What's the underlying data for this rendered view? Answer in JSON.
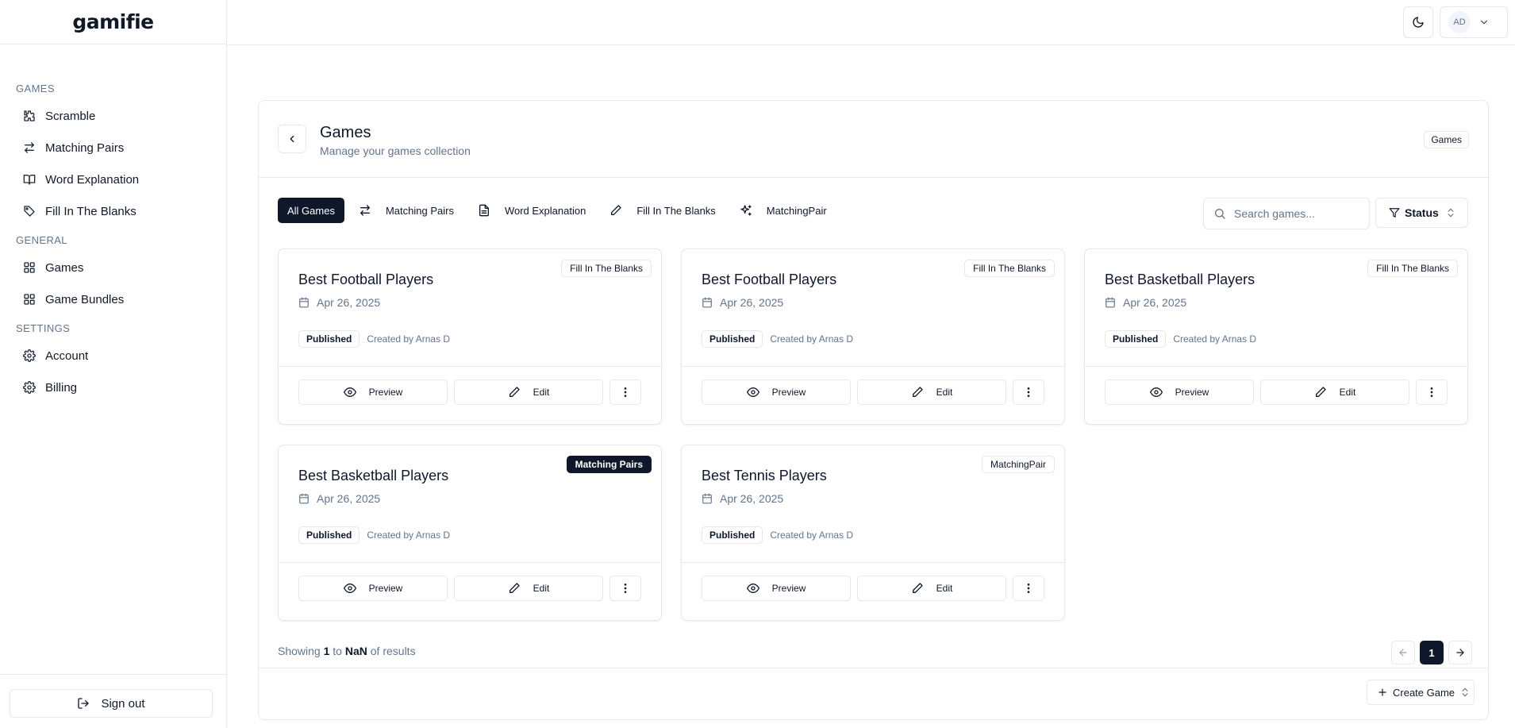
{
  "app": {
    "logo": "gamifie"
  },
  "sidebar": {
    "sections": [
      {
        "title": "GAMES",
        "items": [
          {
            "label": "Scramble",
            "icon": "puzzle-icon"
          },
          {
            "label": "Matching Pairs",
            "icon": "arrows-left-right-icon"
          },
          {
            "label": "Word Explanation",
            "icon": "book-open-icon"
          },
          {
            "label": "Fill In The Blanks",
            "icon": "tag-icon"
          }
        ]
      },
      {
        "title": "GENERAL",
        "items": [
          {
            "label": "Games",
            "icon": "grid-icon"
          },
          {
            "label": "Game Bundles",
            "icon": "grid-icon"
          }
        ]
      },
      {
        "title": "SETTINGS",
        "items": [
          {
            "label": "Account",
            "icon": "gear-icon"
          },
          {
            "label": "Billing",
            "icon": "gear-icon"
          }
        ]
      }
    ],
    "signout_label": "Sign out"
  },
  "topbar": {
    "avatar_initials": "AD"
  },
  "page": {
    "title": "Games",
    "subtitle": "Manage your games collection",
    "breadcrumb": "Games"
  },
  "tabs": [
    {
      "label": "All Games",
      "active": true
    },
    {
      "label": "Matching Pairs",
      "icon": "arrows-left-right-icon"
    },
    {
      "label": "Word Explanation",
      "icon": "file-text-icon"
    },
    {
      "label": "Fill In The Blanks",
      "icon": "pencil-icon"
    },
    {
      "label": "MatchingPair",
      "icon": "sparkles-icon"
    }
  ],
  "search": {
    "placeholder": "Search games...",
    "value": ""
  },
  "filter": {
    "label": "Status"
  },
  "cards": [
    {
      "title": "Best Football Players",
      "date": "Apr 26, 2025",
      "badge": "Fill In The Blanks",
      "badge_dark": false,
      "status": "Published",
      "creator": "Created by Arnas D"
    },
    {
      "title": "Best Football Players",
      "date": "Apr 26, 2025",
      "badge": "Fill In The Blanks",
      "badge_dark": false,
      "status": "Published",
      "creator": "Created by Arnas D"
    },
    {
      "title": "Best Basketball Players",
      "date": "Apr 26, 2025",
      "badge": "Fill In The Blanks",
      "badge_dark": false,
      "status": "Published",
      "creator": "Created by Arnas D"
    },
    {
      "title": "Best Basketball Players",
      "date": "Apr 26, 2025",
      "badge": "Matching Pairs",
      "badge_dark": true,
      "status": "Published",
      "creator": "Created by Arnas D"
    },
    {
      "title": "Best Tennis Players",
      "date": "Apr 26, 2025",
      "badge": "MatchingPair",
      "badge_dark": false,
      "status": "Published",
      "creator": "Created by Arnas D"
    }
  ],
  "card_actions": {
    "preview": "Preview",
    "edit": "Edit"
  },
  "pagination": {
    "showing_prefix": "Showing",
    "from": "1",
    "to_word": "to",
    "to": "NaN",
    "suffix": "of results",
    "current_page": "1"
  },
  "footer": {
    "create_label": "Create Game"
  },
  "colors": {
    "primary": "#0f172a",
    "muted": "#64748b",
    "border": "#e5e7eb"
  }
}
